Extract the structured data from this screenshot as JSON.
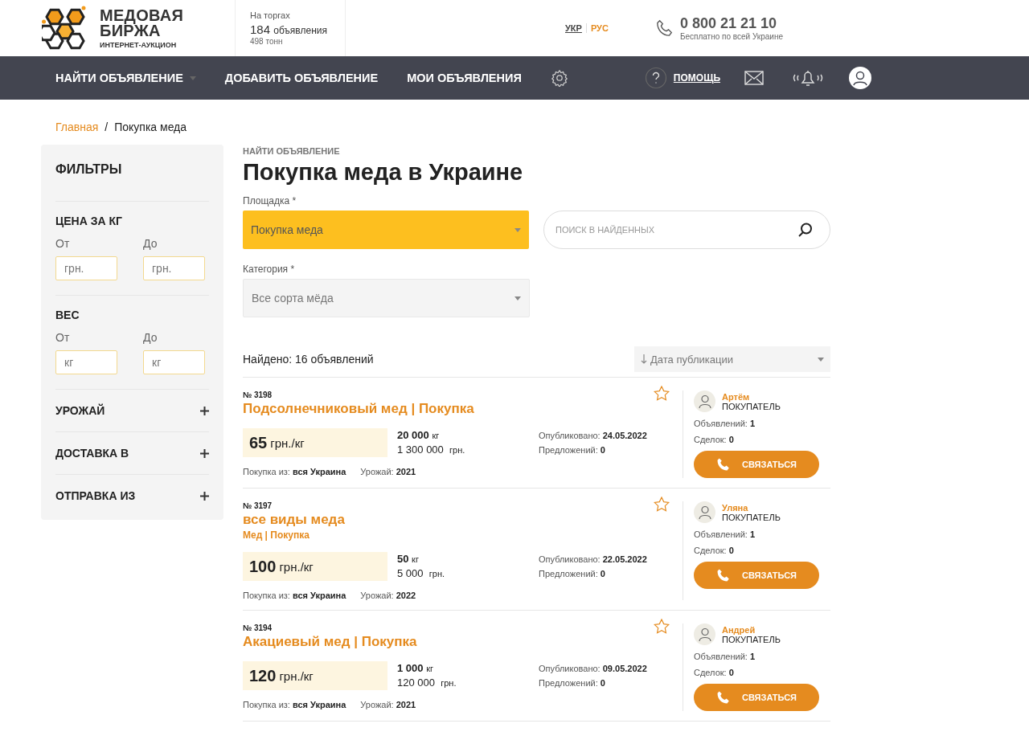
{
  "header": {
    "logo": {
      "lines": [
        "МЕДОВАЯ",
        "БИРЖА"
      ],
      "subtitle": "ИНТЕРНЕТ-АУКЦИОН"
    },
    "stats": {
      "label": "На торгах",
      "count": "184",
      "count_unit": "объявления",
      "tonnage": "498 тонн"
    },
    "languages": [
      {
        "label": "УКР",
        "selected": false
      },
      {
        "label": "РУС",
        "selected": true
      }
    ],
    "phone": {
      "number": "0 800 21 21 10",
      "note": "Бесплатно по всей Украине"
    }
  },
  "nav": {
    "items": [
      {
        "label": "НАЙТИ ОБЪЯВЛЕНИЕ",
        "dropdown": true
      },
      {
        "label": "ДОБАВИТЬ ОБЪЯВЛЕНИЕ",
        "dropdown": false
      },
      {
        "label": "МОИ ОБЪЯВЛЕНИЯ",
        "dropdown": false
      }
    ],
    "help": "ПОМОЩЬ"
  },
  "breadcrumbs": {
    "separator": "/",
    "items": [
      "Главная",
      "Покупка меда"
    ]
  },
  "filters": {
    "title": "ФИЛЬТРЫ",
    "ranges": [
      {
        "title": "ЦЕНА ЗА КГ",
        "from_label": "От",
        "to_label": "До",
        "from_placeholder": "грн.",
        "to_placeholder": "грн."
      },
      {
        "title": "ВЕС",
        "from_label": "От",
        "to_label": "До",
        "from_placeholder": "кг",
        "to_placeholder": "кг"
      }
    ],
    "sections": [
      {
        "title": "УРОЖАЙ",
        "expanded": false
      },
      {
        "title": "ДОСТАВКА В",
        "expanded": false
      },
      {
        "title": "ОТПРАВКА ИЗ",
        "expanded": false
      }
    ]
  },
  "main": {
    "section_label": "НАЙТИ ОБЪЯВЛЕНИЕ",
    "title": "Покупка меда в Украине",
    "platform": {
      "label": "Площадка *",
      "value": "Покупка меда"
    },
    "search": {
      "placeholder": "ПОИСК В НАЙДЕННЫХ"
    },
    "category": {
      "label": "Категория *",
      "value": "Все сорта мёда"
    },
    "found": "Найдено: 16 объявлений",
    "sort": "Дата публикации",
    "listings": [
      {
        "number": "№ 3198",
        "title": "Подсолнечниковый мед | Покупка",
        "price": "65",
        "price_unit": "грн./кг",
        "weight": "20 000",
        "weight_unit": "кг",
        "total": "1 300 000",
        "total_unit": "грн.",
        "published_label": "Опубликовано:",
        "published": "24.05.2022",
        "offers_label": "Предложений:",
        "offers": "0",
        "from_label": "Покупка из:",
        "from": "вся Украина",
        "harvest_label": "Урожай:",
        "harvest": "2021",
        "favorite": false,
        "seller": {
          "name": "Артём",
          "role": "ПОКУПАТЕЛЬ",
          "ads_label": "Объявлений:",
          "ads": "1",
          "deals_label": "Сделок:",
          "deals": "0"
        },
        "contact": "СВЯЗАТЬСЯ"
      },
      {
        "number": "№ 3197",
        "title": "все виды меда",
        "subtitle": "Мед | Покупка",
        "price": "100",
        "price_unit": "грн./кг",
        "weight": "50",
        "weight_unit": "кг",
        "total": "5 000",
        "total_unit": "грн.",
        "published_label": "Опубликовано:",
        "published": "22.05.2022",
        "offers_label": "Предложений:",
        "offers": "0",
        "from_label": "Покупка из:",
        "from": "вся Украина",
        "harvest_label": "Урожай:",
        "harvest": "2022",
        "favorite": false,
        "seller": {
          "name": "Уляна",
          "role": "ПОКУПАТЕЛЬ",
          "ads_label": "Объявлений:",
          "ads": "1",
          "deals_label": "Сделок:",
          "deals": "0"
        },
        "contact": "СВЯЗАТЬСЯ"
      },
      {
        "number": "№ 3194",
        "title": "Акациевый мед | Покупка",
        "price": "120",
        "price_unit": "грн./кг",
        "weight": "1 000",
        "weight_unit": "кг",
        "total": "120 000",
        "total_unit": "грн.",
        "published_label": "Опубликовано:",
        "published": "09.05.2022",
        "offers_label": "Предложений:",
        "offers": "0",
        "from_label": "Покупка из:",
        "from": "вся Украина",
        "harvest_label": "Урожай:",
        "harvest": "2021",
        "favorite": false,
        "seller": {
          "name": "Андрей",
          "role": "ПОКУПАТЕЛЬ",
          "ads_label": "Объявлений:",
          "ads": "1",
          "deals_label": "Сделок:",
          "deals": "0"
        },
        "contact": "СВЯЗАТЬСЯ"
      }
    ]
  }
}
